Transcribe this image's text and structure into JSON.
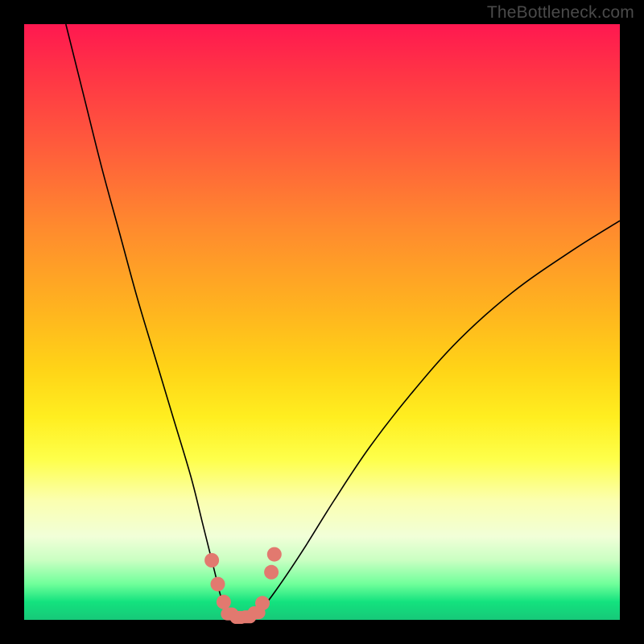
{
  "watermark": "TheBottleneck.com",
  "colors": {
    "background_frame": "#000000",
    "gradient_top": "#ff1850",
    "gradient_mid": "#ffee20",
    "gradient_bottom": "#17c879",
    "curve": "#000000",
    "marker": "#e2796f"
  },
  "chart_data": {
    "type": "line",
    "title": "",
    "xlabel": "",
    "ylabel": "",
    "xlim": [
      0,
      100
    ],
    "ylim": [
      0,
      100
    ],
    "grid": false,
    "notes": "V-shaped bottleneck curve with colored heat-gradient background. X axis is an implicit hardware parameter (0–100). Y axis is bottleneck percentage (0 = balanced, 100 = severe). No tick labels or axis titles are rendered. Marker cluster indicates the near-zero-bottleneck region around x≈33–42.",
    "series": [
      {
        "name": "left-branch",
        "x": [
          7,
          10,
          13,
          16,
          19,
          22,
          25,
          28,
          30,
          32,
          33,
          34,
          35
        ],
        "y": [
          100,
          88,
          76,
          65,
          54,
          44,
          34,
          24,
          16,
          8,
          4,
          2,
          0.5
        ]
      },
      {
        "name": "right-branch",
        "x": [
          38,
          40,
          43,
          47,
          52,
          58,
          65,
          73,
          82,
          92,
          100
        ],
        "y": [
          0.5,
          2,
          6,
          12,
          20,
          29,
          38,
          47,
          55,
          62,
          67
        ]
      }
    ],
    "markers": [
      {
        "x": 31.5,
        "y": 10
      },
      {
        "x": 32.5,
        "y": 6
      },
      {
        "x": 33.5,
        "y": 3
      },
      {
        "x": 34.5,
        "y": 1
      },
      {
        "x": 36.0,
        "y": 0.4
      },
      {
        "x": 37.5,
        "y": 0.5
      },
      {
        "x": 39.0,
        "y": 1.2
      },
      {
        "x": 40.0,
        "y": 2.8
      },
      {
        "x": 41.5,
        "y": 8
      },
      {
        "x": 42.0,
        "y": 11
      }
    ]
  }
}
